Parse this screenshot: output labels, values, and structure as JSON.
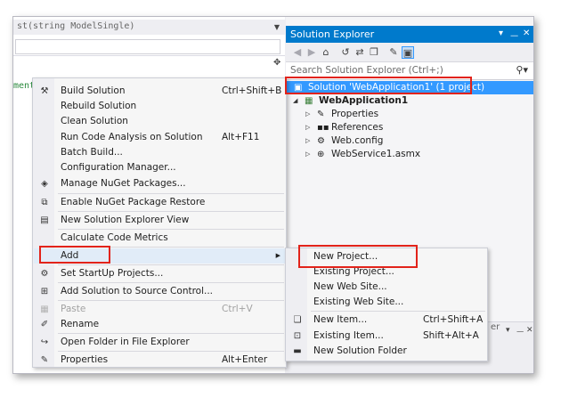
{
  "editor": {
    "top_combo_text": "st(string ModelSingle)",
    "nav_combo_text": "",
    "code_fragment": "ment"
  },
  "solution_explorer": {
    "title": "Solution Explorer",
    "title_controls": [
      "▾",
      " ⊓",
      "✕"
    ],
    "search_placeholder": "Search Solution Explorer (Ctrl+;)",
    "tree": [
      {
        "label": "Solution 'WebApplication1' (1 project)",
        "icon": "solution-icon",
        "selected": true
      },
      {
        "label": "WebApplication1",
        "icon": "web-project-icon",
        "bold": true
      },
      {
        "label": "Properties",
        "icon": "wrench-icon"
      },
      {
        "label": "References",
        "icon": "references-icon"
      },
      {
        "label": "Web.config",
        "icon": "config-file-icon"
      },
      {
        "label": "WebService1.asmx",
        "icon": "webservice-icon"
      }
    ],
    "lower_tail": "er"
  },
  "context_menu": {
    "items": [
      {
        "label": "Build Solution",
        "shortcut": "Ctrl+Shift+B",
        "icon": "build-icon"
      },
      {
        "label": "Rebuild Solution",
        "shortcut": ""
      },
      {
        "label": "Clean Solution",
        "shortcut": ""
      },
      {
        "label": "Run Code Analysis on Solution",
        "shortcut": "Alt+F11"
      },
      {
        "label": "Batch Build...",
        "shortcut": ""
      },
      {
        "label": "Configuration Manager...",
        "shortcut": ""
      },
      {
        "label": "Manage NuGet Packages...",
        "shortcut": "",
        "icon": "nuget-icon"
      },
      {
        "label": "Enable NuGet Package Restore",
        "shortcut": "",
        "icon": "nuget-restore-icon"
      },
      {
        "label": "New Solution Explorer View",
        "shortcut": "",
        "icon": "new-view-icon"
      },
      {
        "label": "Calculate Code Metrics",
        "shortcut": ""
      },
      {
        "label": "Add",
        "shortcut": "",
        "submenu": true
      },
      {
        "label": "Set StartUp Projects...",
        "shortcut": "",
        "icon": "gear-icon"
      },
      {
        "label": "Add Solution to Source Control...",
        "shortcut": "",
        "icon": "source-control-icon"
      },
      {
        "label": "Paste",
        "shortcut": "Ctrl+V",
        "icon": "paste-icon",
        "disabled": true
      },
      {
        "label": "Rename",
        "shortcut": "",
        "icon": "rename-icon"
      },
      {
        "label": "Open Folder in File Explorer",
        "shortcut": "",
        "icon": "open-folder-icon"
      },
      {
        "label": "Properties",
        "shortcut": "Alt+Enter",
        "icon": "wrench-icon"
      }
    ]
  },
  "add_submenu": {
    "items": [
      {
        "label": "New Project...",
        "shortcut": ""
      },
      {
        "label": "Existing Project...",
        "shortcut": ""
      },
      {
        "label": "New Web Site...",
        "shortcut": ""
      },
      {
        "label": "Existing Web Site...",
        "shortcut": ""
      },
      {
        "label": "New Item...",
        "shortcut": "Ctrl+Shift+A",
        "icon": "new-item-icon"
      },
      {
        "label": "Existing Item...",
        "shortcut": "Shift+Alt+A",
        "icon": "existing-item-icon"
      },
      {
        "label": "New Solution Folder",
        "shortcut": "",
        "icon": "new-folder-icon"
      }
    ]
  },
  "colors": {
    "accent": "#007acc",
    "selection": "#3399ff",
    "callout": "#e2231a"
  }
}
